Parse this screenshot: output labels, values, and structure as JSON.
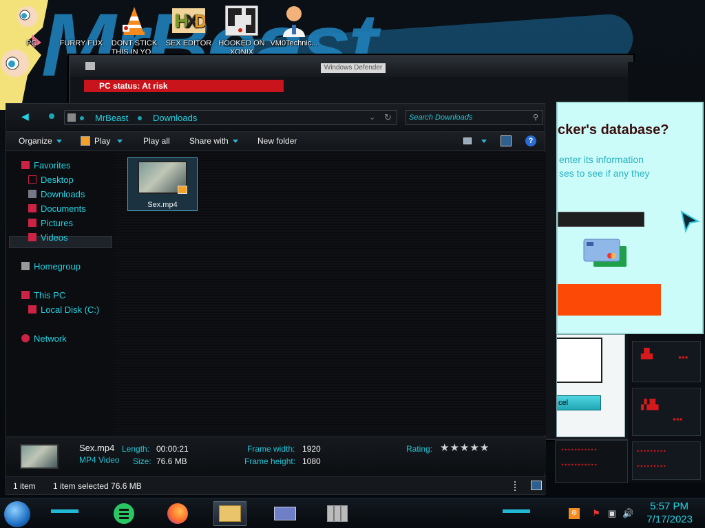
{
  "desktop": {
    "icons": [
      {
        "label": "PC"
      },
      {
        "label": "FURRY FUX"
      },
      {
        "label": "DONT STICK\nTHIS IN YO..."
      },
      {
        "label": "SEX EDITOR"
      },
      {
        "label": "HOOKED ON\nXONIX"
      },
      {
        "label": "VM0Technic..."
      }
    ],
    "wallpaper_text": "MrBeast"
  },
  "background_window": {
    "title": "Windows Defender",
    "alert": "PC status: At risk"
  },
  "scam_popup": {
    "heading": "cker's database?",
    "text_line1": "enter its information",
    "text_line2": "ses to see if any they",
    "cancel_label": "cel"
  },
  "explorer": {
    "breadcrumb": [
      "MrBeast",
      "Downloads"
    ],
    "search_placeholder": "Search Downloads",
    "toolbar": {
      "organize": "Organize",
      "play": "Play",
      "play_all": "Play all",
      "share_with": "Share with",
      "new_folder": "New folder"
    },
    "nav": {
      "favorites": "Favorites",
      "desktop": "Desktop",
      "downloads": "Downloads",
      "documents": "Documents",
      "pictures": "Pictures",
      "videos": "Videos",
      "homegroup": "Homegroup",
      "this_pc": "This PC",
      "local_disk": "Local Disk (C:)",
      "network": "Network"
    },
    "files": [
      {
        "name": "Sex.mp4"
      }
    ],
    "details": {
      "name": "Sex.mp4",
      "type": "MP4 Video",
      "length_label": "Length:",
      "length": "00:00:21",
      "size_label": "Size:",
      "size": "76.6 MB",
      "frame_width_label": "Frame width:",
      "frame_width": "1920",
      "frame_height_label": "Frame height:",
      "frame_height": "1080",
      "rating_label": "Rating:",
      "rating_stars": 0
    },
    "status": {
      "items": "1 item",
      "selected": "1 item selected  76.6 MB"
    }
  },
  "taskbar": {
    "time": "5:57 PM",
    "date": "7/17/2023"
  },
  "colors": {
    "accent": "#22d3e4",
    "alert_red": "#c8141a",
    "scam_button": "#fc4a06"
  }
}
